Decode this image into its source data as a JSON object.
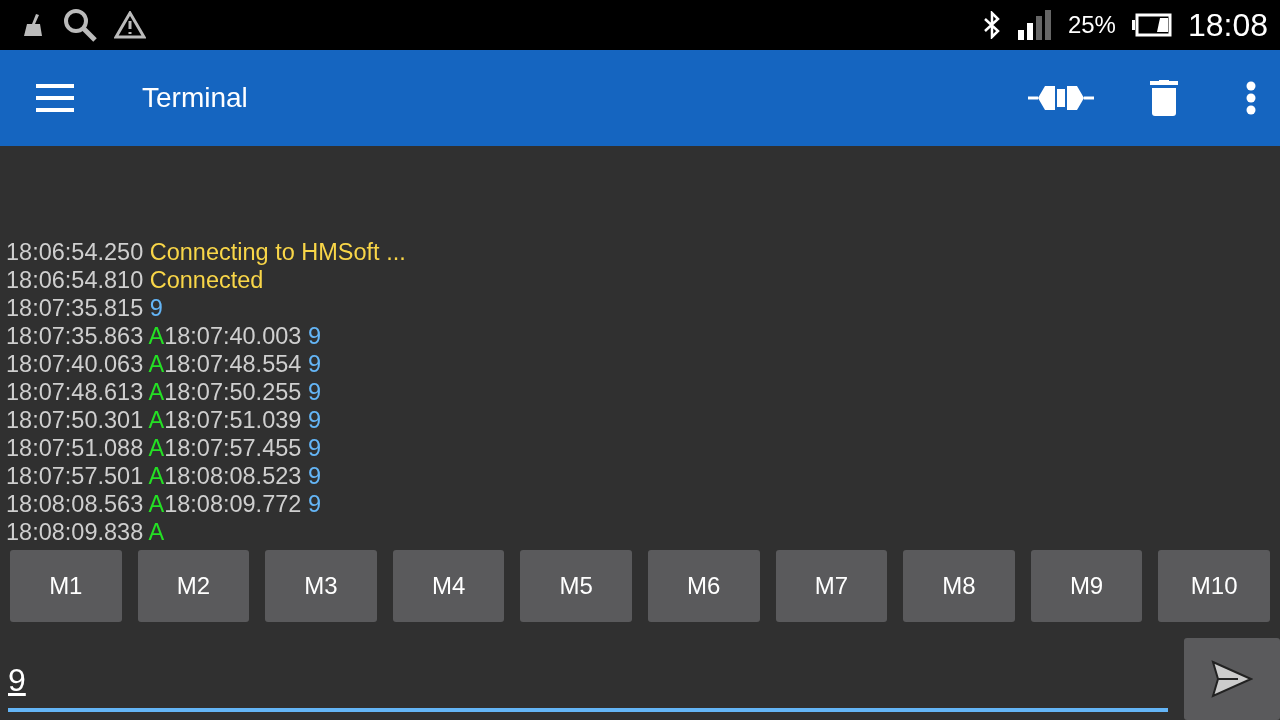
{
  "status_bar": {
    "battery": "25%",
    "time": "18:08"
  },
  "app_bar": {
    "title": "Terminal"
  },
  "log": [
    [
      {
        "kind": "time",
        "text": "18:06:54.250"
      },
      {
        "kind": "status",
        "text": "Connecting to HMSoft ..."
      }
    ],
    [
      {
        "kind": "time",
        "text": "18:06:54.810"
      },
      {
        "kind": "status",
        "text": "Connected"
      }
    ],
    [
      {
        "kind": "time",
        "text": "18:07:35.815"
      },
      {
        "kind": "sent",
        "text": "9"
      }
    ],
    [
      {
        "kind": "time",
        "text": "18:07:35.863"
      },
      {
        "kind": "received",
        "text": "A"
      },
      {
        "kind": "time",
        "text": "18:07:40.003"
      },
      {
        "kind": "sent",
        "text": "9"
      }
    ],
    [
      {
        "kind": "time",
        "text": "18:07:40.063"
      },
      {
        "kind": "received",
        "text": "A"
      },
      {
        "kind": "time",
        "text": "18:07:48.554"
      },
      {
        "kind": "sent",
        "text": "9"
      }
    ],
    [
      {
        "kind": "time",
        "text": "18:07:48.613"
      },
      {
        "kind": "received",
        "text": "A"
      },
      {
        "kind": "time",
        "text": "18:07:50.255"
      },
      {
        "kind": "sent",
        "text": "9"
      }
    ],
    [
      {
        "kind": "time",
        "text": "18:07:50.301"
      },
      {
        "kind": "received",
        "text": "A"
      },
      {
        "kind": "time",
        "text": "18:07:51.039"
      },
      {
        "kind": "sent",
        "text": "9"
      }
    ],
    [
      {
        "kind": "time",
        "text": "18:07:51.088"
      },
      {
        "kind": "received",
        "text": "A"
      },
      {
        "kind": "time",
        "text": "18:07:57.455"
      },
      {
        "kind": "sent",
        "text": "9"
      }
    ],
    [
      {
        "kind": "time",
        "text": "18:07:57.501"
      },
      {
        "kind": "received",
        "text": "A"
      },
      {
        "kind": "time",
        "text": "18:08:08.523"
      },
      {
        "kind": "sent",
        "text": "9"
      }
    ],
    [
      {
        "kind": "time",
        "text": "18:08:08.563"
      },
      {
        "kind": "received",
        "text": "A"
      },
      {
        "kind": "time",
        "text": "18:08:09.772"
      },
      {
        "kind": "sent",
        "text": "9"
      }
    ],
    [
      {
        "kind": "time",
        "text": "18:08:09.838"
      },
      {
        "kind": "received",
        "text": "A"
      }
    ]
  ],
  "macros": [
    "M1",
    "M2",
    "M3",
    "M4",
    "M5",
    "M6",
    "M7",
    "M8",
    "M9",
    "M10"
  ],
  "input": {
    "value": "9"
  }
}
